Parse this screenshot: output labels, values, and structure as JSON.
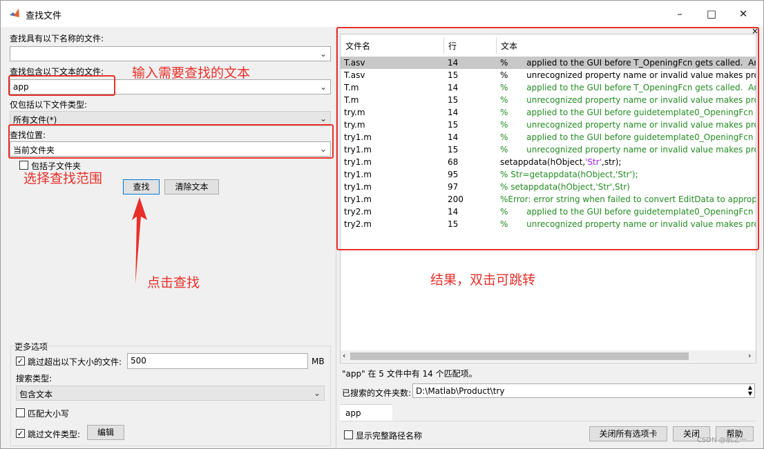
{
  "window": {
    "title": "查找文件"
  },
  "left": {
    "name_label": "查找具有以下名称的文件:",
    "name_value": "",
    "text_label": "查找包含以下文本的文件:",
    "text_value": "app",
    "type_label": "仅包括以下文件类型:",
    "type_value": "所有文件(*)",
    "location_label": "查找位置:",
    "location_value": "当前文件夹",
    "include_subfolders": "包括子文件夹",
    "find_button": "查找",
    "clear_button": "清除文本",
    "more_options": "更多选项",
    "skip_size_label": "跳过超出以下大小的文件:",
    "skip_size_value": "500",
    "size_unit": "MB",
    "search_type_label": "搜索类型:",
    "search_type_value": "包含文本",
    "match_case": "匹配大小写",
    "skip_types": "跳过文件类型:",
    "edit_button": "编辑"
  },
  "annotations": {
    "input_text": "输入需要查找的文本",
    "choose_scope": "选择查找范围",
    "click_find": "点击查找",
    "result_hint": "结果，双击可跳转"
  },
  "results": {
    "columns": [
      "文件名",
      "行",
      "文本"
    ],
    "rows": [
      {
        "file": "T.asv",
        "line": "14",
        "text": "%       applied to the GUI before T_OpeningFcn gets called.  An",
        "green": false,
        "selected": true
      },
      {
        "file": "T.asv",
        "line": "15",
        "text": "%       unrecognized property name or invalid value makes prop",
        "green": false,
        "selected": false
      },
      {
        "file": "T.m",
        "line": "14",
        "text": "%       applied to the GUI before T_OpeningFcn gets called.  An",
        "green": true,
        "selected": false
      },
      {
        "file": "T.m",
        "line": "15",
        "text": "%       unrecognized property name or invalid value makes prop",
        "green": true,
        "selected": false
      },
      {
        "file": "try.m",
        "line": "14",
        "text": "%       applied to the GUI before guidetemplate0_OpeningFcn ge",
        "green": true,
        "selected": false
      },
      {
        "file": "try.m",
        "line": "15",
        "text": "%       unrecognized property name or invalid value makes prop",
        "green": true,
        "selected": false
      },
      {
        "file": "try1.m",
        "line": "14",
        "text": "%       applied to the GUI before guidetemplate0_OpeningFcn ge",
        "green": true,
        "selected": false
      },
      {
        "file": "try1.m",
        "line": "15",
        "text": "%       unrecognized property name or invalid value makes prop",
        "green": true,
        "selected": false
      },
      {
        "file": "try1.m",
        "line": "68",
        "text": "setappdata(hObject,'Str',str);",
        "green": false,
        "selected": false
      },
      {
        "file": "try1.m",
        "line": "95",
        "text": "% Str=getappdata(hObject,'Str');",
        "green": true,
        "selected": false
      },
      {
        "file": "try1.m",
        "line": "97",
        "text": "% setappdata(hObject,'Str',Str)",
        "green": true,
        "selected": false
      },
      {
        "file": "try1.m",
        "line": "200",
        "text": "%Error: error string when failed to convert EditData to appropr",
        "green": true,
        "selected": false
      },
      {
        "file": "try2.m",
        "line": "14",
        "text": "%       applied to the GUI before guidetemplate0_OpeningFcn ge",
        "green": true,
        "selected": false
      },
      {
        "file": "try2.m",
        "line": "15",
        "text": "%       unrecognized property name or invalid value makes prop",
        "green": true,
        "selected": false
      }
    ],
    "summary": "\"app\" 在 5 文件中有 14 个匹配项。",
    "searched_label": "已搜索的文件夹数:",
    "searched_path": "D:\\Matlab\\Product\\try",
    "tab": "app"
  },
  "bottom": {
    "show_full_path": "显示完整路径名称",
    "close_all_tabs": "关闭所有选项卡",
    "close": "关闭",
    "help": "帮助",
    "watermark": "CSDN @肌之一"
  },
  "colors": {
    "annotation_red": "#e8302a",
    "comment_green": "#228b22",
    "string_purple": "#a020f0"
  }
}
